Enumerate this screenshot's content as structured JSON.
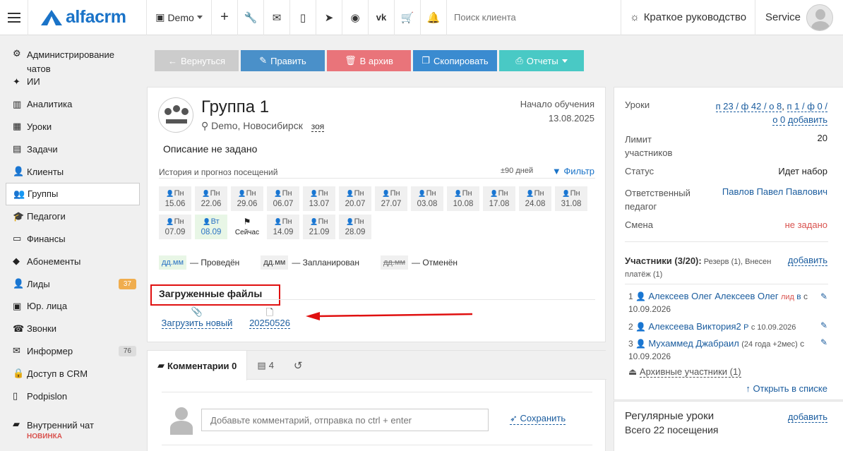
{
  "topbar": {
    "logo": "alfacrm",
    "branch": "Demo",
    "search_placeholder": "Поиск клиента",
    "guide": "Краткое руководство",
    "user": "Service"
  },
  "sidebar": {
    "items": [
      {
        "label": "Администрирование чатов",
        "icon": "gear-icon"
      },
      {
        "label": "ИИ",
        "icon": "sparkle-icon"
      },
      {
        "label": "Аналитика",
        "icon": "book-icon"
      },
      {
        "label": "Уроки",
        "icon": "calendar-icon"
      },
      {
        "label": "Задачи",
        "icon": "clipboard-icon"
      },
      {
        "label": "Клиенты",
        "icon": "user-icon"
      },
      {
        "label": "Группы",
        "icon": "users-icon"
      },
      {
        "label": "Педагоги",
        "icon": "graduation-icon"
      },
      {
        "label": "Финансы",
        "icon": "money-icon"
      },
      {
        "label": "Абонементы",
        "icon": "tag-icon"
      },
      {
        "label": "Лиды",
        "icon": "user-plus-icon",
        "badge": "37"
      },
      {
        "label": "Юр. лица",
        "icon": "briefcase-icon"
      },
      {
        "label": "Звонки",
        "icon": "phone-icon"
      },
      {
        "label": "Информер",
        "icon": "envelope-icon",
        "badge": "76"
      },
      {
        "label": "Доступ в CRM",
        "icon": "lock-icon"
      },
      {
        "label": "Podpislon",
        "icon": "file-icon"
      },
      {
        "label": "Внутренний чат",
        "icon": "chat-icon",
        "tag": "НОВИНКА"
      }
    ]
  },
  "actions": {
    "back": "Вернуться",
    "edit": "Править",
    "archive": "В архив",
    "copy": "Скопировать",
    "reports": "Отчеты"
  },
  "group": {
    "title": "Группа 1",
    "location": "Demo, Новосибирск",
    "room": "зоя",
    "start_label": "Начало обучения",
    "start_date": "13.08.2025",
    "description": "Описание не задано",
    "history_label": "История и прогноз посещений",
    "days_label": "±90 дней",
    "filter_label": "Фильтр",
    "dates": [
      {
        "dow": "Пн",
        "date": "15.06",
        "state": "plan"
      },
      {
        "dow": "Пн",
        "date": "22.06",
        "state": "plan"
      },
      {
        "dow": "Пн",
        "date": "29.06",
        "state": "plan"
      },
      {
        "dow": "Пн",
        "date": "06.07",
        "state": "plan"
      },
      {
        "dow": "Пн",
        "date": "13.07",
        "state": "plan"
      },
      {
        "dow": "Пн",
        "date": "20.07",
        "state": "plan"
      },
      {
        "dow": "Пн",
        "date": "27.07",
        "state": "plan"
      },
      {
        "dow": "Пн",
        "date": "03.08",
        "state": "plan"
      },
      {
        "dow": "Пн",
        "date": "10.08",
        "state": "plan"
      },
      {
        "dow": "Пн",
        "date": "17.08",
        "state": "plan"
      },
      {
        "dow": "Пн",
        "date": "24.08",
        "state": "plan"
      },
      {
        "dow": "Пн",
        "date": "31.08",
        "state": "plan"
      },
      {
        "dow": "Пн",
        "date": "07.09",
        "state": "plan"
      },
      {
        "dow": "Вт",
        "date": "08.09",
        "state": "done"
      },
      {
        "dow": "",
        "date": "Сейчас",
        "state": "now"
      },
      {
        "dow": "Пн",
        "date": "14.09",
        "state": "plan"
      },
      {
        "dow": "Пн",
        "date": "21.09",
        "state": "plan"
      },
      {
        "dow": "Пн",
        "date": "28.09",
        "state": "plan"
      }
    ],
    "legend": {
      "sample": "дд.мм",
      "done": "— Проведён",
      "plan": "— Запланирован",
      "cancel": "— Отменён"
    },
    "files_title": "Загруженные файлы",
    "upload_label": "Загрузить новый",
    "file_name": "20250526"
  },
  "comments": {
    "tab_comments": "Комментарии 0",
    "tab_second": "4",
    "placeholder": "Добавьте комментарий, отправка по ctrl + enter",
    "save": "Сохранить"
  },
  "right": {
    "lessons_label": "Уроки",
    "lessons_val1": "п 23 / ф 42 / о 8",
    "lessons_val2": "п 1 / ф 0 /",
    "lessons_val3": "о 0",
    "lessons_add": "добавить",
    "limit_label1": "Лимит",
    "limit_label2": "участников",
    "limit_val": "20",
    "status_label": "Статус",
    "status_val": "Идет набор",
    "resp_label1": "Ответственный",
    "resp_label2": "педагог",
    "resp_val": "Павлов Павел Павлович",
    "shift_label": "Смена",
    "shift_val": "не задано",
    "participants_title": "Участники (3/20):",
    "participants_sub1": "Резерв (1), Внесен",
    "participants_sub2": "платёж (1)",
    "participants_add": "добавить",
    "members": [
      {
        "num": "1",
        "name": "Алексеев Олег Алексеев Олег",
        "lid": "лид",
        "inv": "в",
        "from": "с",
        "date": "10.09.2026"
      },
      {
        "num": "2",
        "name": "Алексеева Виктория2",
        "flag": "Р",
        "from": "с 10.09.2026"
      },
      {
        "num": "3",
        "name": "Мухаммед Джабраил",
        "age": "(24 года +2мес)",
        "from": "с",
        "date": "10.09.2026"
      }
    ],
    "archive": "Архивные участники (1)",
    "open_list": "Открыть в списке",
    "regular_title": "Регулярные уроки",
    "regular_add": "добавить",
    "regular_total": "Всего 22 посещения"
  }
}
